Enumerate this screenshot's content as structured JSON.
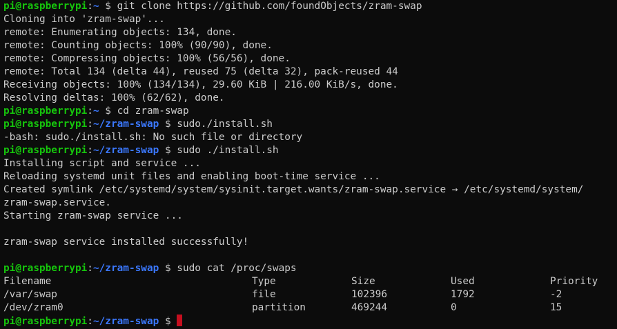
{
  "prompt": {
    "user_host": "pi@raspberrypi",
    "colon": ":",
    "home_path": "~",
    "zram_path": "~/zram-swap",
    "dollar": " $ "
  },
  "commands": {
    "git_clone": "git clone https://github.com/foundObjects/zram-swap",
    "cd": "cd zram-swap",
    "install_bad": "sudo./install.sh",
    "install": "sudo ./install.sh",
    "cat_swaps": "sudo cat /proc/swaps"
  },
  "output": {
    "cloning": "Cloning into 'zram-swap'...",
    "enumerating": "remote: Enumerating objects: 134, done.",
    "counting": "remote: Counting objects: 100% (90/90), done.",
    "compressing": "remote: Compressing objects: 100% (56/56), done.",
    "total": "remote: Total 134 (delta 44), reused 75 (delta 32), pack-reused 44",
    "receiving": "Receiving objects: 100% (134/134), 29.60 KiB | 216.00 KiB/s, done.",
    "resolving": "Resolving deltas: 100% (62/62), done.",
    "bash_error": "-bash: sudo./install.sh: No such file or directory",
    "installing": "Installing script and service ...",
    "reloading": "Reloading systemd unit files and enabling boot-time service ...",
    "symlink_1": "Created symlink /etc/systemd/system/sysinit.target.wants/zram-swap.service → /etc/systemd/system/",
    "symlink_2": "zram-swap.service.",
    "starting": "Starting zram-swap service ...",
    "success": "zram-swap service installed successfully!"
  },
  "swaps_table": {
    "headers": [
      "Filename",
      "Type",
      "Size",
      "Used",
      "Priority"
    ],
    "rows": [
      [
        "/var/swap",
        "file",
        "102396",
        "1792",
        "-2"
      ],
      [
        "/dev/zram0",
        "partition",
        "469244",
        "0",
        "15"
      ]
    ]
  },
  "colors": {
    "background": "#0c0c0c",
    "text": "#cccccc",
    "user_host": "#16c60c",
    "path": "#3b78ff",
    "cursor": "#c50f1f"
  }
}
